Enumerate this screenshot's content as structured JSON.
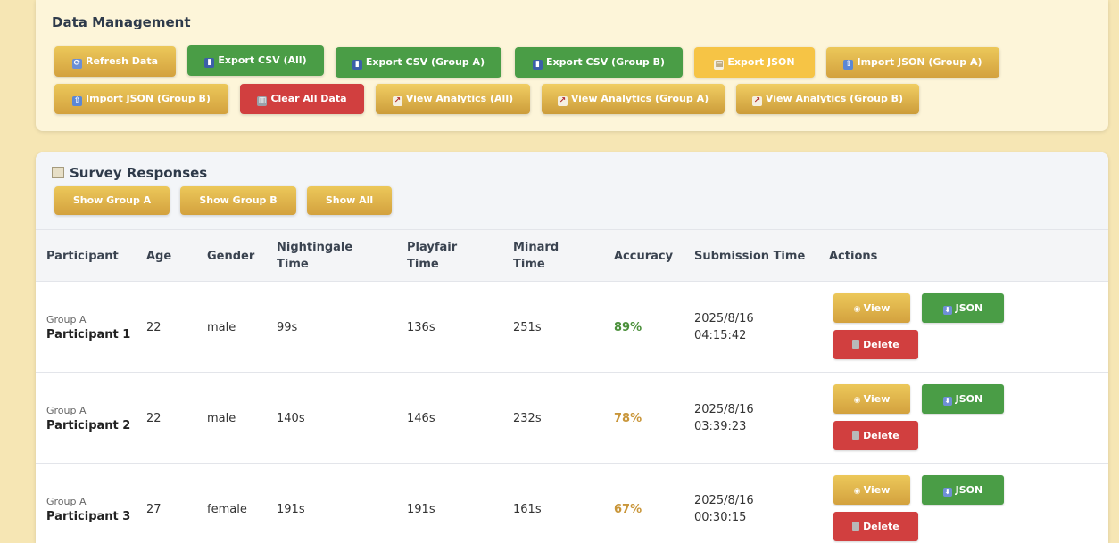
{
  "data_management": {
    "title": "Data Management",
    "buttons_row1": [
      {
        "icon": "refresh-icon",
        "glyph": "⟳",
        "label": "Refresh Data"
      },
      {
        "icon": "bar-chart-icon",
        "glyph": "▮",
        "label": "Export CSV (All)"
      },
      {
        "icon": "bar-chart-icon",
        "glyph": "▮",
        "label": "Export CSV (Group A)"
      },
      {
        "icon": "bar-chart-icon",
        "glyph": "▮",
        "label": "Export CSV (Group B)"
      },
      {
        "icon": "document-icon",
        "glyph": "▤",
        "label": "Export JSON"
      },
      {
        "icon": "upload-icon",
        "glyph": "⇧",
        "label": "Import JSON (Group A)"
      }
    ],
    "buttons_row2": [
      {
        "icon": "upload-icon",
        "glyph": "⇧",
        "label": "Import JSON (Group B)"
      },
      {
        "icon": "trash-icon",
        "glyph": "▥",
        "label": "Clear All Data"
      },
      {
        "icon": "line-chart-icon",
        "glyph": "↗",
        "label": "View Analytics (All)"
      },
      {
        "icon": "line-chart-icon",
        "glyph": "↗",
        "label": "View Analytics (Group A)"
      },
      {
        "icon": "line-chart-icon",
        "glyph": "↗",
        "label": "View Analytics (Group B)"
      }
    ]
  },
  "survey_responses": {
    "title": "Survey Responses",
    "title_icon": "clipboard-icon",
    "filters": [
      "Show Group A",
      "Show Group B",
      "Show All"
    ],
    "columns": {
      "participant": "Participant",
      "age": "Age",
      "gender": "Gender",
      "nightingale_1": "Nightingale",
      "nightingale_2": "Time",
      "playfair_1": "Playfair",
      "playfair_2": "Time",
      "minard_1": "Minard",
      "minard_2": "Time",
      "accuracy": "Accuracy",
      "submission": "Submission Time",
      "actions": "Actions"
    },
    "action_labels": {
      "view": "View",
      "json": "JSON",
      "delete": "Delete"
    },
    "rows": [
      {
        "group": "Group A",
        "name": "Participant 1",
        "age": "22",
        "gender": "male",
        "nightingale": "99s",
        "playfair": "136s",
        "minard": "251s",
        "accuracy": "89%",
        "date": "2025/8/16",
        "time": "04:15:42"
      },
      {
        "group": "Group A",
        "name": "Participant 2",
        "age": "22",
        "gender": "male",
        "nightingale": "140s",
        "playfair": "146s",
        "minard": "232s",
        "accuracy": "78%",
        "date": "2025/8/16",
        "time": "03:39:23"
      },
      {
        "group": "Group A",
        "name": "Participant 3",
        "age": "27",
        "gender": "female",
        "nightingale": "191s",
        "playfair": "191s",
        "minard": "161s",
        "accuracy": "67%",
        "date": "2025/8/16",
        "time": "00:30:15"
      }
    ]
  },
  "colors": {
    "accuracy_high": "#4a8f3a",
    "accuracy_mid": "#c9963a"
  }
}
